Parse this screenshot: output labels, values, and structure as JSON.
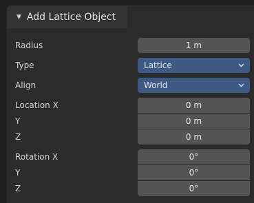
{
  "panel": {
    "title": "Add Lattice Object",
    "collapse_glyph": "▼"
  },
  "radius": {
    "label": "Radius",
    "value": "1 m"
  },
  "type": {
    "label": "Type",
    "value": "Lattice"
  },
  "align": {
    "label": "Align",
    "value": "World"
  },
  "location": {
    "x_label": "Location X",
    "x_value": "0 m",
    "y_label": "Y",
    "y_value": "0 m",
    "z_label": "Z",
    "z_value": "0 m"
  },
  "rotation": {
    "x_label": "Rotation X",
    "x_value": "0°",
    "y_label": "Y",
    "y_value": "0°",
    "z_label": "Z",
    "z_value": "0°"
  },
  "colors": {
    "panel_bg": "#2b2b2b",
    "field_bg": "#545454",
    "dropdown_bg": "#3d5a85"
  }
}
